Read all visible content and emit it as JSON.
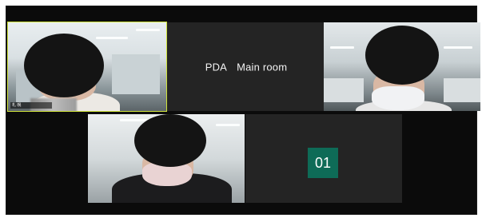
{
  "meeting": {
    "room_title": {
      "prefix": "PDA",
      "name": "Main room"
    },
    "participants": [
      {
        "tile": "active-speaker",
        "name_label": "札 幌"
      },
      {
        "tile": "participant-2",
        "name_label": ""
      },
      {
        "tile": "participant-3",
        "name_label": ""
      }
    ],
    "number_tile": {
      "label": "01"
    },
    "colors": {
      "background": "#0b0b0b",
      "tile_bg": "#242424",
      "active_speaker_border": "#cfe23a",
      "number_badge": "#0e6b57"
    }
  }
}
